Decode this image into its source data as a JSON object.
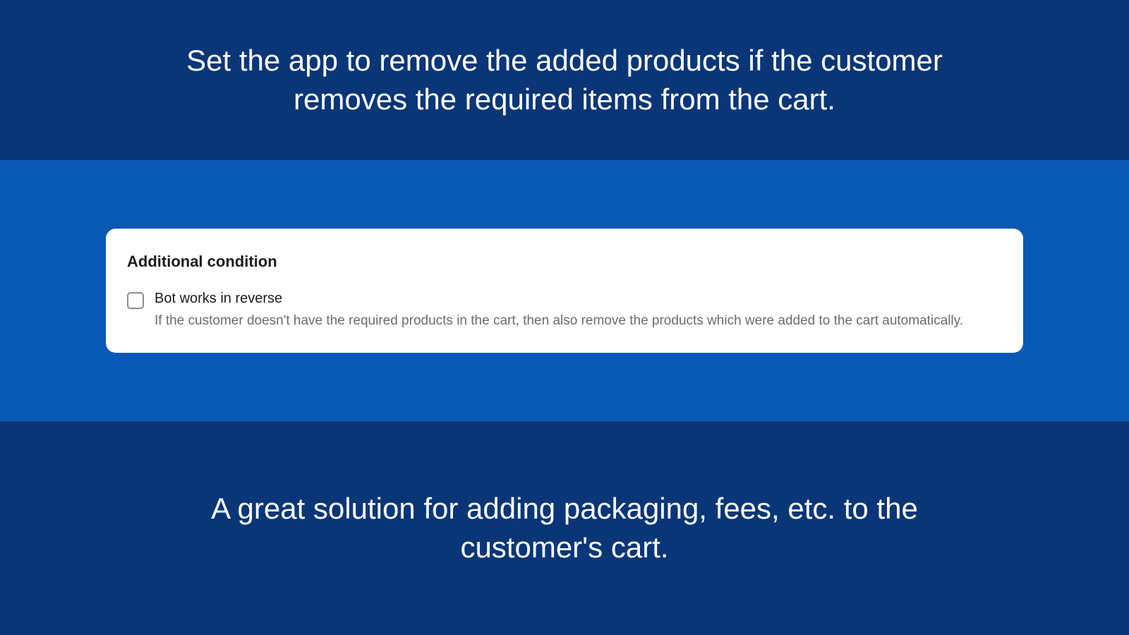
{
  "colors": {
    "banner_dark": "#0a3678",
    "banner_light": "#0958b5",
    "card_bg": "#ffffff",
    "text_dark": "#1c1c1c",
    "text_muted": "#6b6b6b"
  },
  "top_banner": {
    "text": "Set the app to remove the added products if the customer removes the required items from the cart."
  },
  "card": {
    "title": "Additional condition",
    "checkbox": {
      "checked": false,
      "label": "Bot works in reverse",
      "description": "If the customer doesn't have the required products in the cart, then also remove the products which were added to the cart automatically."
    }
  },
  "bottom_banner": {
    "text": "A great solution for adding packaging, fees, etc. to the customer's cart."
  }
}
